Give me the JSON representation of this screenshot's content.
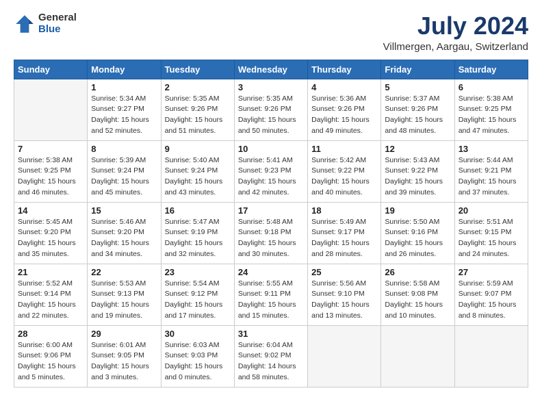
{
  "header": {
    "logo_general": "General",
    "logo_blue": "Blue",
    "month_title": "July 2024",
    "location": "Villmergen, Aargau, Switzerland"
  },
  "weekdays": [
    "Sunday",
    "Monday",
    "Tuesday",
    "Wednesday",
    "Thursday",
    "Friday",
    "Saturday"
  ],
  "weeks": [
    [
      {
        "day": "",
        "info": ""
      },
      {
        "day": "1",
        "info": "Sunrise: 5:34 AM\nSunset: 9:27 PM\nDaylight: 15 hours\nand 52 minutes."
      },
      {
        "day": "2",
        "info": "Sunrise: 5:35 AM\nSunset: 9:26 PM\nDaylight: 15 hours\nand 51 minutes."
      },
      {
        "day": "3",
        "info": "Sunrise: 5:35 AM\nSunset: 9:26 PM\nDaylight: 15 hours\nand 50 minutes."
      },
      {
        "day": "4",
        "info": "Sunrise: 5:36 AM\nSunset: 9:26 PM\nDaylight: 15 hours\nand 49 minutes."
      },
      {
        "day": "5",
        "info": "Sunrise: 5:37 AM\nSunset: 9:26 PM\nDaylight: 15 hours\nand 48 minutes."
      },
      {
        "day": "6",
        "info": "Sunrise: 5:38 AM\nSunset: 9:25 PM\nDaylight: 15 hours\nand 47 minutes."
      }
    ],
    [
      {
        "day": "7",
        "info": "Sunrise: 5:38 AM\nSunset: 9:25 PM\nDaylight: 15 hours\nand 46 minutes."
      },
      {
        "day": "8",
        "info": "Sunrise: 5:39 AM\nSunset: 9:24 PM\nDaylight: 15 hours\nand 45 minutes."
      },
      {
        "day": "9",
        "info": "Sunrise: 5:40 AM\nSunset: 9:24 PM\nDaylight: 15 hours\nand 43 minutes."
      },
      {
        "day": "10",
        "info": "Sunrise: 5:41 AM\nSunset: 9:23 PM\nDaylight: 15 hours\nand 42 minutes."
      },
      {
        "day": "11",
        "info": "Sunrise: 5:42 AM\nSunset: 9:22 PM\nDaylight: 15 hours\nand 40 minutes."
      },
      {
        "day": "12",
        "info": "Sunrise: 5:43 AM\nSunset: 9:22 PM\nDaylight: 15 hours\nand 39 minutes."
      },
      {
        "day": "13",
        "info": "Sunrise: 5:44 AM\nSunset: 9:21 PM\nDaylight: 15 hours\nand 37 minutes."
      }
    ],
    [
      {
        "day": "14",
        "info": "Sunrise: 5:45 AM\nSunset: 9:20 PM\nDaylight: 15 hours\nand 35 minutes."
      },
      {
        "day": "15",
        "info": "Sunrise: 5:46 AM\nSunset: 9:20 PM\nDaylight: 15 hours\nand 34 minutes."
      },
      {
        "day": "16",
        "info": "Sunrise: 5:47 AM\nSunset: 9:19 PM\nDaylight: 15 hours\nand 32 minutes."
      },
      {
        "day": "17",
        "info": "Sunrise: 5:48 AM\nSunset: 9:18 PM\nDaylight: 15 hours\nand 30 minutes."
      },
      {
        "day": "18",
        "info": "Sunrise: 5:49 AM\nSunset: 9:17 PM\nDaylight: 15 hours\nand 28 minutes."
      },
      {
        "day": "19",
        "info": "Sunrise: 5:50 AM\nSunset: 9:16 PM\nDaylight: 15 hours\nand 26 minutes."
      },
      {
        "day": "20",
        "info": "Sunrise: 5:51 AM\nSunset: 9:15 PM\nDaylight: 15 hours\nand 24 minutes."
      }
    ],
    [
      {
        "day": "21",
        "info": "Sunrise: 5:52 AM\nSunset: 9:14 PM\nDaylight: 15 hours\nand 22 minutes."
      },
      {
        "day": "22",
        "info": "Sunrise: 5:53 AM\nSunset: 9:13 PM\nDaylight: 15 hours\nand 19 minutes."
      },
      {
        "day": "23",
        "info": "Sunrise: 5:54 AM\nSunset: 9:12 PM\nDaylight: 15 hours\nand 17 minutes."
      },
      {
        "day": "24",
        "info": "Sunrise: 5:55 AM\nSunset: 9:11 PM\nDaylight: 15 hours\nand 15 minutes."
      },
      {
        "day": "25",
        "info": "Sunrise: 5:56 AM\nSunset: 9:10 PM\nDaylight: 15 hours\nand 13 minutes."
      },
      {
        "day": "26",
        "info": "Sunrise: 5:58 AM\nSunset: 9:08 PM\nDaylight: 15 hours\nand 10 minutes."
      },
      {
        "day": "27",
        "info": "Sunrise: 5:59 AM\nSunset: 9:07 PM\nDaylight: 15 hours\nand 8 minutes."
      }
    ],
    [
      {
        "day": "28",
        "info": "Sunrise: 6:00 AM\nSunset: 9:06 PM\nDaylight: 15 hours\nand 5 minutes."
      },
      {
        "day": "29",
        "info": "Sunrise: 6:01 AM\nSunset: 9:05 PM\nDaylight: 15 hours\nand 3 minutes."
      },
      {
        "day": "30",
        "info": "Sunrise: 6:03 AM\nSunset: 9:03 PM\nDaylight: 15 hours\nand 0 minutes."
      },
      {
        "day": "31",
        "info": "Sunrise: 6:04 AM\nSunset: 9:02 PM\nDaylight: 14 hours\nand 58 minutes."
      },
      {
        "day": "",
        "info": ""
      },
      {
        "day": "",
        "info": ""
      },
      {
        "day": "",
        "info": ""
      }
    ]
  ]
}
